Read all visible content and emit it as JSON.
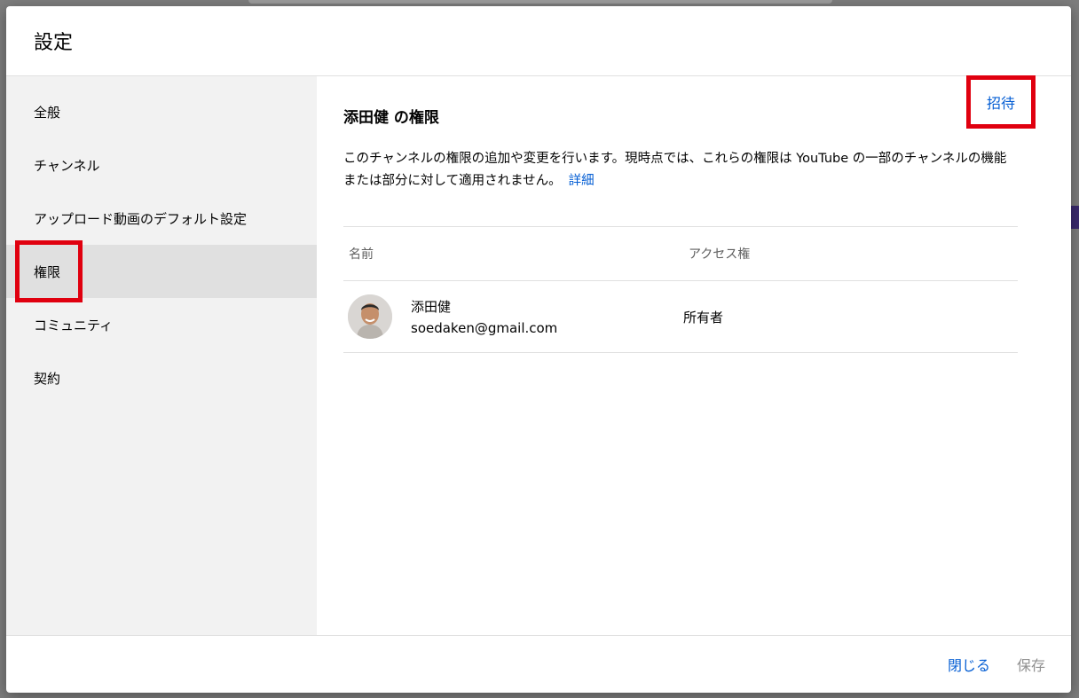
{
  "dialog": {
    "title": "設定"
  },
  "sidebar": {
    "items": [
      {
        "label": "全般"
      },
      {
        "label": "チャンネル"
      },
      {
        "label": "アップロード動画のデフォルト設定"
      },
      {
        "label": "権限"
      },
      {
        "label": "コミュニティ"
      },
      {
        "label": "契約"
      }
    ],
    "active_index": 3
  },
  "permissions": {
    "title": "添田健 の権限",
    "invite_label": "招待",
    "description": "このチャンネルの権限の追加や変更を行います。現時点では、これらの権限は YouTube の一部のチャンネルの機能または部分に対して適用されません。",
    "learn_more": "詳細",
    "columns": {
      "name": "名前",
      "access": "アクセス権"
    },
    "members": [
      {
        "name": "添田健",
        "email": "soedaken@gmail.com",
        "access": "所有者"
      }
    ]
  },
  "footer": {
    "close_label": "閉じる",
    "save_label": "保存"
  },
  "colors": {
    "accent": "#065fd4",
    "highlight": "#e0000f",
    "sidebar_bg": "#f2f2f2",
    "active_bg": "#e0e0e0"
  }
}
